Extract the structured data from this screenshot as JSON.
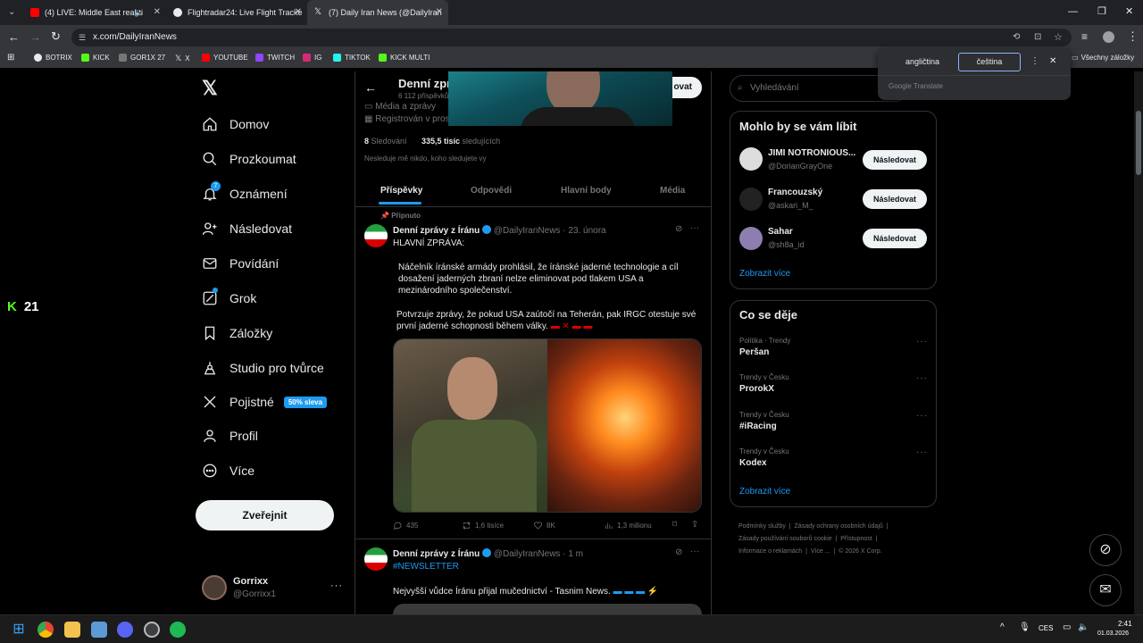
{
  "browser": {
    "tabs": [
      {
        "title": "(4) LIVE: Middle East real-ti",
        "color": "#ff0000"
      },
      {
        "title": "Flightradar24: Live Flight Tracke",
        "color": "#e8eaed"
      },
      {
        "title": "(7) Daily Iran News (@DailyIran",
        "color": "#e8eaed"
      }
    ],
    "url": "x.com/DailyIranNews",
    "bookmarks": [
      "BOTRIX",
      "KICK",
      "GOR1X 27",
      "X",
      "YOUTUBE",
      "TWITCH",
      "IG",
      "TIKTOK",
      "KICK MULTI"
    ],
    "all_bookmarks": "Všechny záložky"
  },
  "translate_popup": {
    "lang_source": "angličtina",
    "lang_target": "čeština",
    "footer": "Google Translate"
  },
  "overlay": {
    "kick_count": "21"
  },
  "sidebar": {
    "items": [
      {
        "label": "Domov"
      },
      {
        "label": "Prozkoumat"
      },
      {
        "label": "Oznámení",
        "badge": "7"
      },
      {
        "label": "Následovat"
      },
      {
        "label": "Povídání"
      },
      {
        "label": "Grok"
      },
      {
        "label": "Záložky"
      },
      {
        "label": "Studio pro tvůrce"
      },
      {
        "label": "Pojistné",
        "badge": "50% sleva"
      },
      {
        "label": "Profil"
      },
      {
        "label": "Více"
      }
    ],
    "post_button": "Zveřejnit",
    "account": {
      "name": "Gorrixx",
      "handle": "@Gorrixx1"
    }
  },
  "profile": {
    "header_name": "Denní zpr",
    "posts_count": "6 112 příspěvků",
    "category": "Média a zprávy",
    "registered": "Registrován v pros",
    "follow_label": "ovat",
    "following_count": "8",
    "following_label": "Sledování",
    "followers_count": "335,5 tisíc",
    "followers_label": "sledujících",
    "not_followed": "Nesleduje mě nikdo, koho sledujete vy",
    "tabs": [
      "Příspěvky",
      "Odpovědi",
      "Hlavní body",
      "Média"
    ]
  },
  "tweets": [
    {
      "pinned": "Připnuto",
      "name": "Denní zprávy z Íránu",
      "handle": "@DailyIranNews",
      "time": "· 23. února",
      "lines": [
        "HLAVNÍ ZPRÁVA:",
        "Náčelník íránské armády prohlásil, že íránské jaderné technologie a cíl dosažení jaderných zbraní nelze eliminovat pod tlakem USA a mezinárodního společenství.",
        "Potvrzuje zprávy, že pokud USA zaútočí na Teherán, pak IRGC otestuje své první jaderné schopnosti během války."
      ],
      "replies": "435",
      "reposts": "1,6 tisíce",
      "likes": "8K",
      "views": "1,3 milionu"
    },
    {
      "name": "Denní zprávy z Íránu",
      "handle": "@DailyIranNews",
      "time": "· 1 m",
      "hashtag": "#NEWSLETTER",
      "text": "Nejvyšší vůdce Íránu přijal mučednictví - Tasnim News."
    }
  ],
  "right": {
    "search_placeholder": "Vyhledávání",
    "suggest_title": "Mohlo by se vám líbit",
    "suggestions": [
      {
        "name": "JIMI NOTRONIOUS...",
        "handle": "@DorianGrayOne",
        "button": "Následovat"
      },
      {
        "name": "Francouzský",
        "handle": "@askari_M_",
        "button": "Následovat"
      },
      {
        "name": "Sahar",
        "handle": "@sh8a_id",
        "button": "Následovat"
      }
    ],
    "show_more": "Zobrazit více",
    "trends_title": "Co se děje",
    "trends": [
      {
        "meta": "Politika · Trendy",
        "name": "Peršan"
      },
      {
        "meta": "Trendy v Česku",
        "name": "ProrokX"
      },
      {
        "meta": "Trendy v Česku",
        "name": "#iRacing"
      },
      {
        "meta": "Trendy v Česku",
        "name": "Kodex"
      }
    ],
    "trends_more": "Zobrazit více",
    "footer": [
      "Podmínky služby",
      "Zásady ochrany osobních údajů",
      "Zásady používání souborů cookie",
      "Přístupnost",
      "Informace o reklamách",
      "Více ...",
      "© 2026 X Corp."
    ]
  },
  "taskbar": {
    "lang": "CES",
    "time": "2:41",
    "date": "01.03.2026"
  }
}
